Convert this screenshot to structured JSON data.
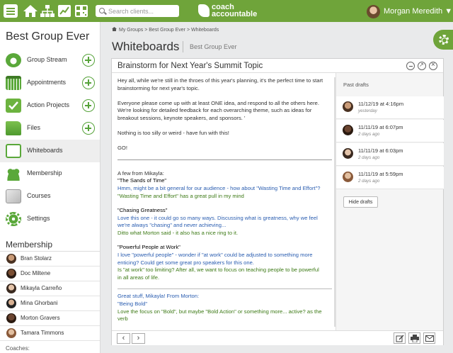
{
  "topbar": {
    "search_placeholder": "Search clients...",
    "logo_line1": "coach",
    "logo_line2": "accountable",
    "user_name": "Morgan Meredith ▼",
    "brand_color": "#6fa43a"
  },
  "sidebar": {
    "group_title": "Best Group Ever",
    "nav": [
      {
        "label": "Group Stream",
        "icon": "group-stream-icon",
        "has_add": true
      },
      {
        "label": "Appointments",
        "icon": "calendar-icon",
        "has_add": true
      },
      {
        "label": "Action Projects",
        "icon": "checkbox-icon",
        "has_add": true
      },
      {
        "label": "Files",
        "icon": "folder-icon",
        "has_add": true
      },
      {
        "label": "Whiteboards",
        "icon": "whiteboard-icon",
        "has_add": false,
        "active": true
      },
      {
        "label": "Membership",
        "icon": "people-icon",
        "has_add": false
      },
      {
        "label": "Courses",
        "icon": "courses-icon",
        "has_add": false
      },
      {
        "label": "Settings",
        "icon": "gear-icon",
        "has_add": false
      }
    ],
    "membership_title": "Membership",
    "members": [
      "Bran Stolarz",
      "Doc Miltene",
      "Mikayla Carreño",
      "Mina Ghorbani",
      "Morton Gravers",
      "Tamara Timmons"
    ],
    "coaches_label": "Coaches:"
  },
  "breadcrumb": {
    "items": [
      "My Groups",
      "Best Group Ever",
      "Whiteboards"
    ],
    "separator": ">"
  },
  "page": {
    "title": "Whiteboards",
    "subtitle": "Best Group Ever"
  },
  "whiteboard": {
    "title": "Brainstorm for Next Year's Summit Topic",
    "intro": [
      "Hey all, while we're still in the throes of this year's planning, it's the perfect time to start brainstorming for next year's topic.",
      "Everyone please come up with at least ONE idea, and respond to all the others here. We're looking for detailed feedback for each overarching theme, such as ideas for breakout sessions, keynote speakers, and sponsors. '",
      "Nothing is too silly or weird - have fun with this!",
      "GO!"
    ],
    "mikayla_intro": "A few from Mikayla:",
    "blocks": [
      {
        "lines": [
          {
            "text": "\"The Sands of Time\"",
            "color": "black"
          },
          {
            "text": "Hmm, might be a bit general for our audience - how about \"Wasting Time and Effort\"?",
            "color": "blue"
          },
          {
            "text": "\"Wasting Time and Effort\" has a great pull in my mind",
            "color": "green"
          }
        ]
      },
      {
        "lines": [
          {
            "text": "\"Chasing Greatness\"",
            "color": "black"
          },
          {
            "text": "Love this one - it could go so many ways. Discussing what is greatness, why we feel",
            "color": "blue"
          },
          {
            "text": "we're always \"chasing\" and never achieving...",
            "color": "blue"
          },
          {
            "text": "Ditto what Morton said - it also has a nice ring to it.",
            "color": "green"
          }
        ]
      },
      {
        "lines": [
          {
            "text": "\"Powerful People at Work\"",
            "color": "black"
          },
          {
            "text": "I love \"powerful people\" - wonder if \"at work\" could be adjusted to something more",
            "color": "blue"
          },
          {
            "text": "enticing? Could get some great pro speakers for this one.",
            "color": "blue"
          },
          {
            "text": "Is \"at work\" too limiting? After all, we want to focus on teaching people to be powerful",
            "color": "green"
          },
          {
            "text": "in all areas of life.",
            "color": "green"
          }
        ]
      }
    ],
    "morton_intro": "Great stuff, Mikayla! From Morton:",
    "morton_block": [
      {
        "text": "\"Being Bold\"",
        "color": "blue"
      },
      {
        "text": "Love the focus on \"Bold\", but maybe \"Bold Action\" or something more... active? as the",
        "color": "green"
      },
      {
        "text": "verb",
        "color": "green"
      }
    ],
    "text_colors": {
      "black": "#000000",
      "blue": "#2a5db0",
      "green": "#3d7a16"
    }
  },
  "drafts": {
    "title": "Past drafts",
    "items": [
      {
        "date": "11/12/19 at 4:16pm",
        "ago": "yesterday"
      },
      {
        "date": "11/11/19 at 6:07pm",
        "ago": "2 days ago"
      },
      {
        "date": "11/11/19 at 6:03pm",
        "ago": "2 days ago"
      },
      {
        "date": "11/11/19 at 5:59pm",
        "ago": "2 days ago"
      }
    ],
    "hide_label": "Hide drafts"
  },
  "footer": {
    "prev": "‹",
    "next": "›"
  }
}
